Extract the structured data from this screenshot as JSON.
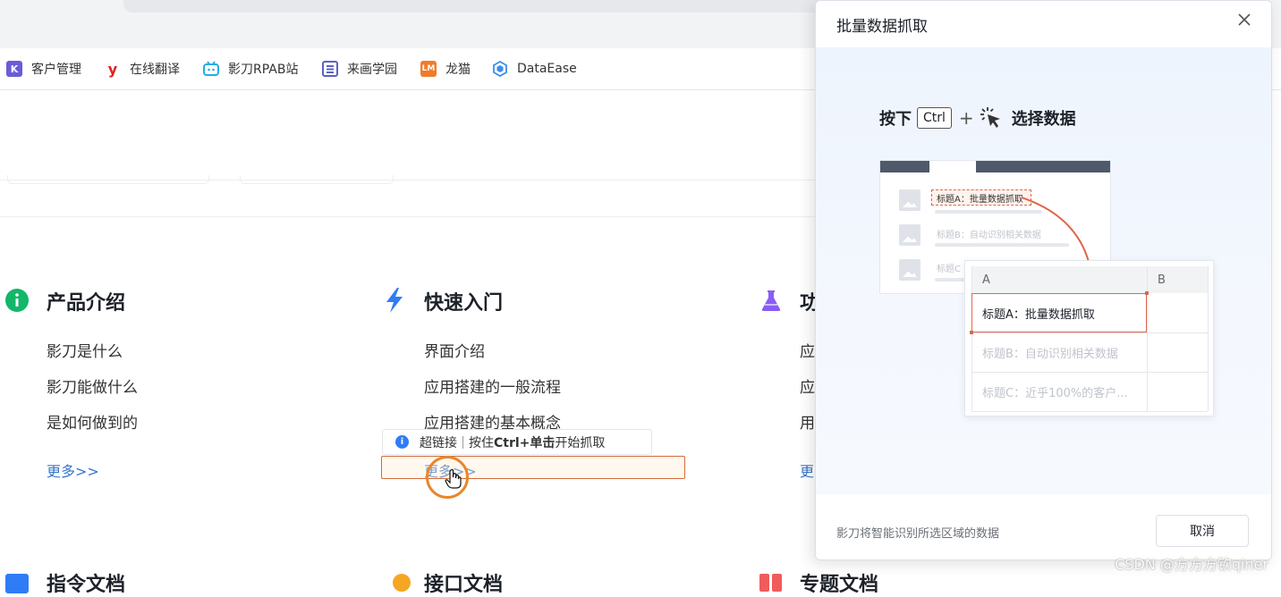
{
  "bookmarks": [
    {
      "label": "客户管理",
      "icon": "kanban-icon",
      "color": "#6b5bd8"
    },
    {
      "label": "在线翻译",
      "icon": "youdao-icon",
      "color": "#e02020"
    },
    {
      "label": "影刀RPAB站",
      "icon": "bilibili-icon",
      "color": "#23ade5"
    },
    {
      "label": "来画学园",
      "icon": "laihua-icon",
      "color": "#5a62c7"
    },
    {
      "label": "龙猫",
      "icon": "longmao-icon",
      "color": "#f07c2a"
    },
    {
      "label": "DataEase",
      "icon": "dataease-icon",
      "color": "#3a8ee6"
    }
  ],
  "sections": {
    "product": {
      "title": "产品介绍",
      "links": [
        "影刀是什么",
        "影刀能做什么",
        "是如何做到的"
      ],
      "more": "更多>>",
      "icon_color": "#12b76a"
    },
    "quickstart": {
      "title": "快速入门",
      "links": [
        "界面介绍",
        "应用搭建的一般流程",
        "应用搭建的基本概念"
      ],
      "more": "更多>>",
      "icon_color": "#2f7cf6"
    },
    "feature": {
      "title": "功",
      "links": [
        "应",
        "应",
        "用"
      ],
      "more": "更",
      "icon_color": "#8a5cf5"
    },
    "bottom": [
      "指令文档",
      "接口文档",
      "专题文档"
    ]
  },
  "capture_tip": {
    "kind": "超链接",
    "instruction_prefix": "按住 ",
    "shortcut": "Ctrl+单击",
    "instruction_suffix": " 开始抓取"
  },
  "dialog": {
    "title": "批量数据抓取",
    "hint_press": "按下",
    "hint_key": "Ctrl",
    "hint_plus": "+",
    "hint_select": "选择数据",
    "illustration": {
      "page_items": [
        "标题A：批量数据抓取",
        "标题B：自动识别相关数据",
        "标题C"
      ],
      "columns": [
        "A",
        "B"
      ],
      "rows": [
        "标题A：批量数据抓取",
        "标题B：自动识别相关数据",
        "标题C：近乎100%的客户..."
      ]
    },
    "footer_hint": "影刀将智能识别所选区域的数据",
    "cancel_label": "取消"
  },
  "watermark": "CSDN @方方方钦qiner",
  "colors": {
    "link_blue": "#3875c6",
    "selection_red": "#e0664a",
    "cursor_orange": "#e8872b"
  }
}
